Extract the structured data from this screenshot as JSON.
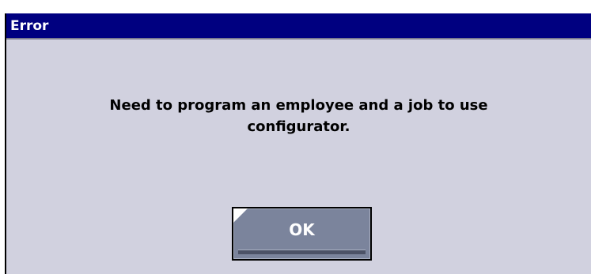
{
  "dialog": {
    "title": "Error",
    "message_line1": "Need to program an employee and a job to use",
    "message_line2": "configurator.",
    "ok_label": "OK"
  },
  "colors": {
    "titlebar": "#000080",
    "dialog_background": "#d1d1df",
    "button_background": "#7b849c"
  }
}
